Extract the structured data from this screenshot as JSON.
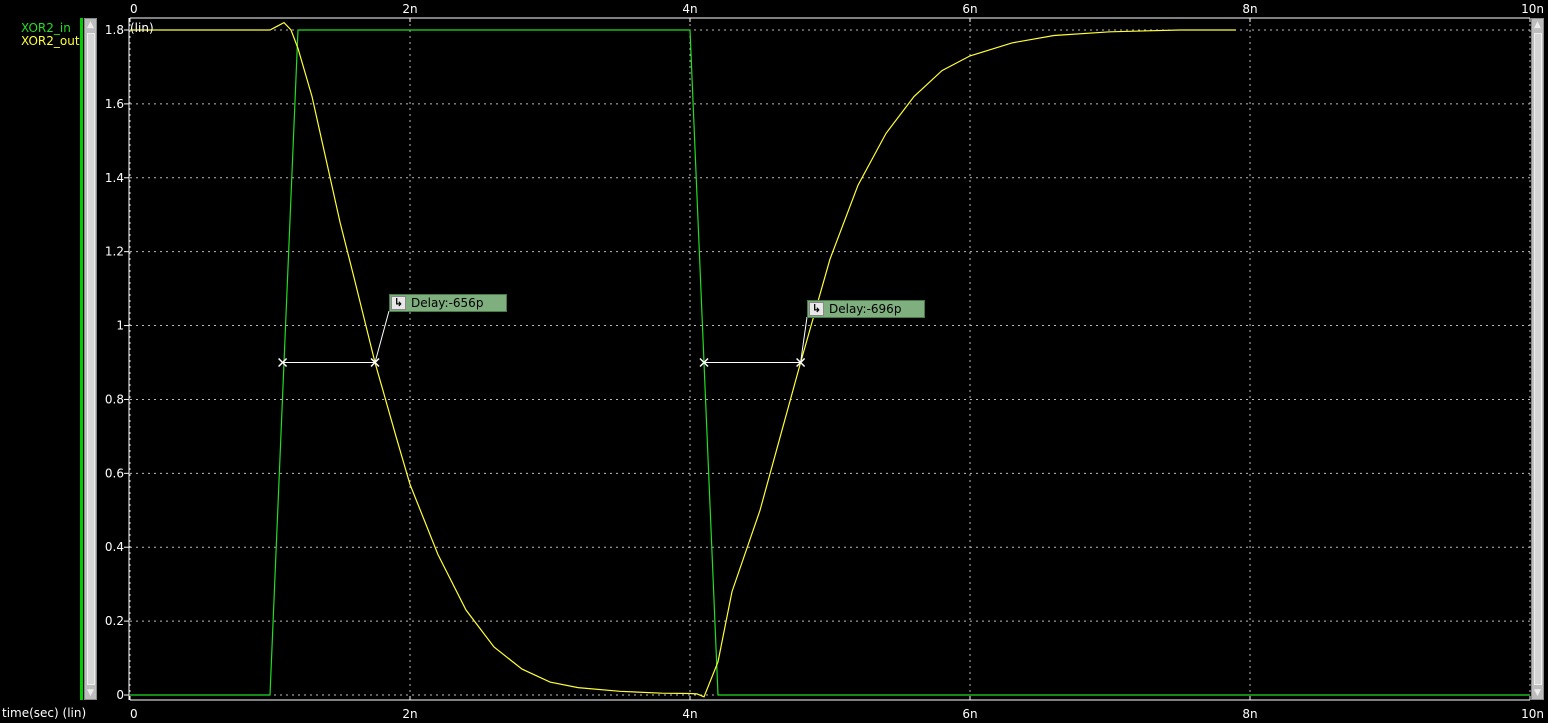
{
  "legend": {
    "items": [
      {
        "label": "XOR2_in",
        "color": "#22dd22"
      },
      {
        "label": "XOR2_out",
        "color": "#ffff33"
      }
    ]
  },
  "yaxis": {
    "scale_label": "(lin)"
  },
  "xaxis": {
    "title": "time(sec) (lin)"
  },
  "measurements": [
    {
      "label": "Delay:-656p",
      "t_start": 1.09e-09,
      "t_end": 1.75e-09,
      "level": 0.9
    },
    {
      "label": "Delay:-696p",
      "t_start": 4.1e-09,
      "t_end": 4.79e-09,
      "level": 0.9
    }
  ],
  "chart_data": {
    "type": "line",
    "xlabel": "time(sec) (lin)",
    "ylabel": "(lin)",
    "xlim": [
      0,
      1e-08
    ],
    "ylim": [
      0,
      1.8
    ],
    "x_ticks": [
      {
        "value": 0,
        "label": "0"
      },
      {
        "value": 2e-09,
        "label": "2n"
      },
      {
        "value": 4e-09,
        "label": "4n"
      },
      {
        "value": 6e-09,
        "label": "6n"
      },
      {
        "value": 8e-09,
        "label": "8n"
      },
      {
        "value": 1e-08,
        "label": "10n"
      }
    ],
    "y_ticks": [
      {
        "value": 0,
        "label": "0"
      },
      {
        "value": 0.2,
        "label": "0.2"
      },
      {
        "value": 0.4,
        "label": "0.4"
      },
      {
        "value": 0.6,
        "label": "0.6"
      },
      {
        "value": 0.8,
        "label": "0.8"
      },
      {
        "value": 1.0,
        "label": "1"
      },
      {
        "value": 1.2,
        "label": "1.2"
      },
      {
        "value": 1.4,
        "label": "1.4"
      },
      {
        "value": 1.6,
        "label": "1.6"
      },
      {
        "value": 1.8,
        "label": "1.8"
      }
    ],
    "grid": true,
    "series": [
      {
        "name": "XOR2_in",
        "color": "#22dd22",
        "x": [
          0,
          1e-09,
          1.2e-09,
          4e-09,
          4.2e-09,
          1e-08
        ],
        "y": [
          0,
          0,
          1.8,
          1.8,
          0,
          0
        ]
      },
      {
        "name": "XOR2_out",
        "color": "#ffff33",
        "x": [
          0,
          1e-09,
          1.05e-09,
          1.1e-09,
          1.15e-09,
          1.2e-09,
          1.3e-09,
          1.4e-09,
          1.5e-09,
          1.6e-09,
          1.75e-09,
          1.9e-09,
          2e-09,
          2.2e-09,
          2.4e-09,
          2.6e-09,
          2.8e-09,
          3e-09,
          3.2e-09,
          3.5e-09,
          3.8e-09,
          4e-09,
          4.05e-09,
          4.1e-09,
          4.2e-09,
          4.3e-09,
          4.5e-09,
          4.79e-09,
          5e-09,
          5.2e-09,
          5.4e-09,
          5.6e-09,
          5.8e-09,
          6e-09,
          6.3e-09,
          6.6e-09,
          7e-09,
          7.5e-09,
          7.9e-09
        ],
        "y": [
          1.8,
          1.8,
          1.81,
          1.82,
          1.8,
          1.75,
          1.62,
          1.45,
          1.28,
          1.13,
          0.9,
          0.7,
          0.57,
          0.38,
          0.23,
          0.13,
          0.07,
          0.035,
          0.02,
          0.01,
          0.005,
          0.004,
          0.003,
          -0.005,
          0.09,
          0.28,
          0.5,
          0.9,
          1.18,
          1.38,
          1.52,
          1.62,
          1.69,
          1.73,
          1.765,
          1.785,
          1.795,
          1.8,
          1.8
        ]
      }
    ]
  }
}
